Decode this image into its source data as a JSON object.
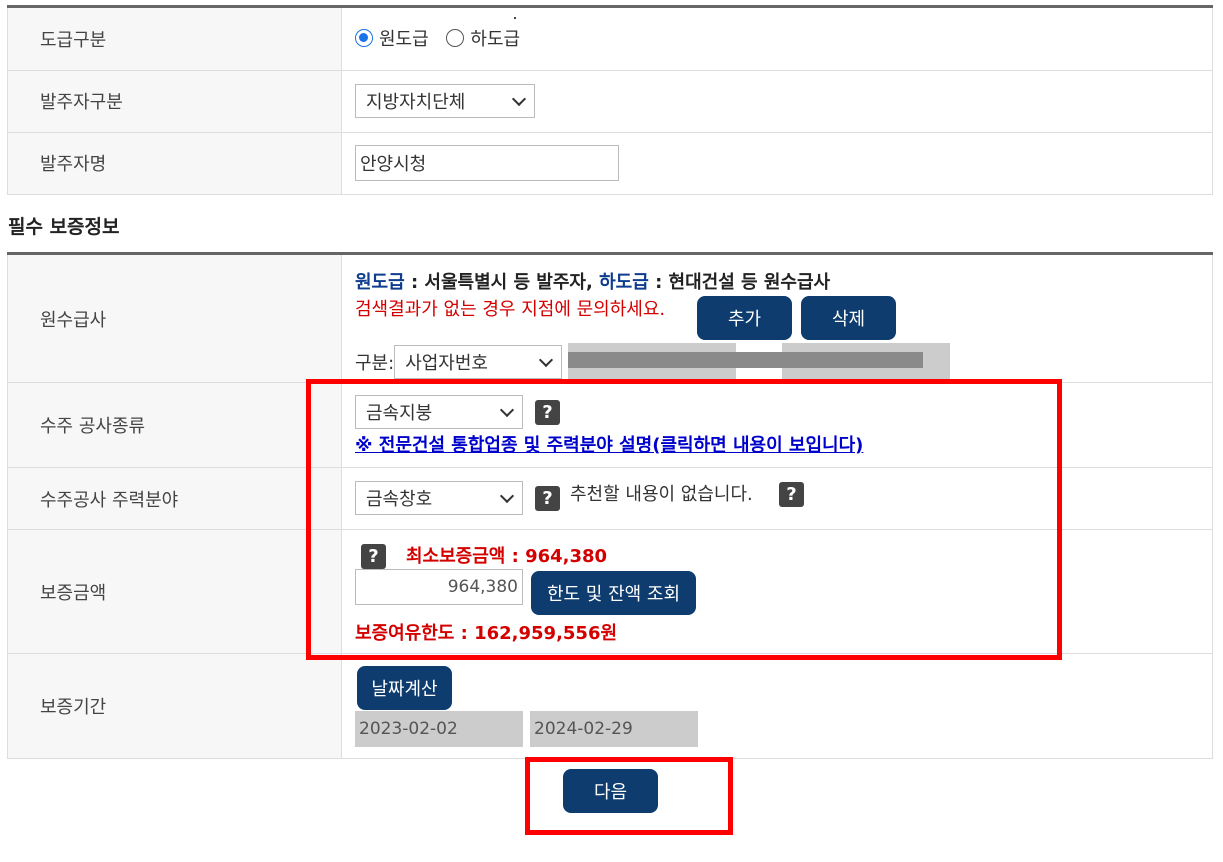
{
  "contract": {
    "label": "도급구분",
    "options": [
      "원도급",
      "하도급"
    ],
    "selected": "원도급"
  },
  "orderer_type": {
    "label": "발주자구분",
    "value": "지방자치단체"
  },
  "orderer_name": {
    "label": "발주자명",
    "value": "안양시청"
  },
  "section_title": "필수 보증정보",
  "prime": {
    "label": "원수급사",
    "note_part1": "원도급",
    "note_part2": " : 서울특별시 등 발주자, ",
    "note_part3": "하도급",
    "note_part4": " : 현대건설 등 원수급사",
    "warn": "검색결과가 없는 경우 지점에 문의하세요.",
    "add_label": "추가",
    "delete_label": "삭제",
    "type_prefix": "구분:",
    "type_value": "사업자번호"
  },
  "work_type": {
    "label": "수주 공사종류",
    "value": "금속지붕",
    "link": "※ 전문건설 통합업종 및 주력분야 설명(클릭하면 내용이 보입니다)"
  },
  "main_field": {
    "label": "수주공사 주력분야",
    "value": "금속창호",
    "recommend": "추천할 내용이 없습니다."
  },
  "amount": {
    "label": "보증금액",
    "min_text": "최소보증금액 : 964,380",
    "value": "964,380",
    "query_label": "한도 및 잔액 조회",
    "limit_text": "보증여유한도 : 162,959,556원"
  },
  "period": {
    "label": "보증기간",
    "calc_label": "날짜계산",
    "start": "2023-02-02",
    "end": "2024-02-29"
  },
  "next_label": "다음",
  "colors": {
    "button": "#0e3c6e",
    "highlight": "#ff0000",
    "warning": "#d40000",
    "link": "#0000cc"
  }
}
